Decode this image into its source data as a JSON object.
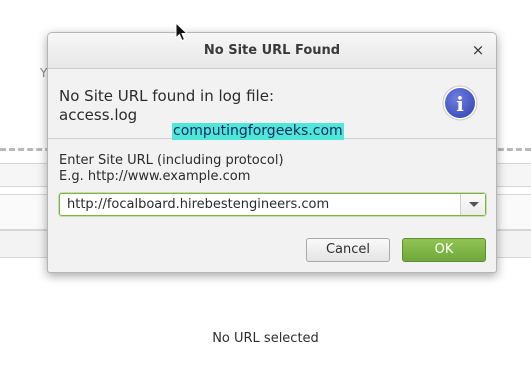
{
  "background": {
    "edge_text_left": "Y",
    "edge_text_right": "d",
    "status_text": "No URL selected"
  },
  "dialog": {
    "title": "No Site URL Found",
    "close_glyph": "×",
    "message_line1": "No Site URL found in log file:",
    "message_line2": "access.log",
    "watermark": "computingforgeeks.com",
    "info_icon_glyph": "i",
    "prompt_line1": "Enter Site URL (including protocol)",
    "prompt_line2": "E.g. http://www.example.com",
    "url_input": {
      "value": "http://focalboard.hirebestengineers.com"
    },
    "cancel_label": "Cancel",
    "ok_label": "OK"
  },
  "colors": {
    "ok_button": "#7cb342",
    "input_focus_border": "#7fb33d",
    "info_icon": "#4a5bc4",
    "watermark_bg": "#4fe8d8"
  }
}
